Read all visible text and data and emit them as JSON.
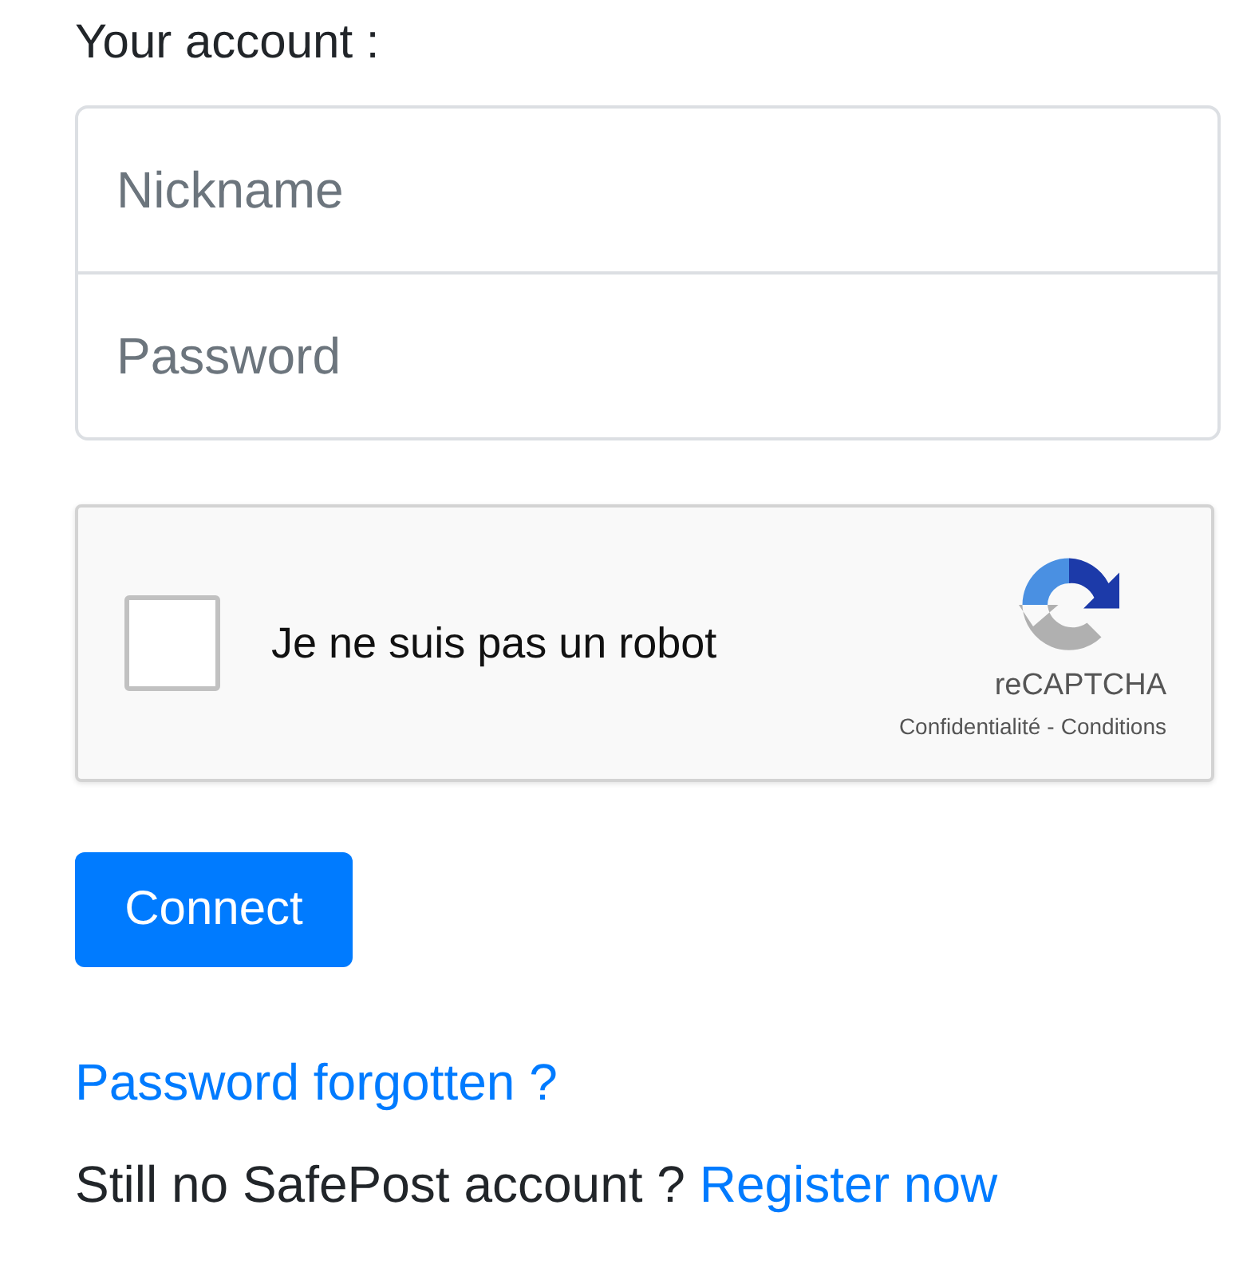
{
  "heading": "Your account :",
  "fields": [
    {
      "placeholder": "Nickname"
    },
    {
      "placeholder": "Password"
    }
  ],
  "captcha": {
    "label": "Je ne suis pas un robot",
    "checked": false,
    "brand": "reCAPTCHA",
    "privacy": "Confidentialité",
    "separator": "-",
    "terms": "Conditions"
  },
  "connect_button": "Connect",
  "forgot_link": "Password forgotten ?",
  "register": {
    "text": "Still no SafePost account ?",
    "link": "Register now"
  }
}
